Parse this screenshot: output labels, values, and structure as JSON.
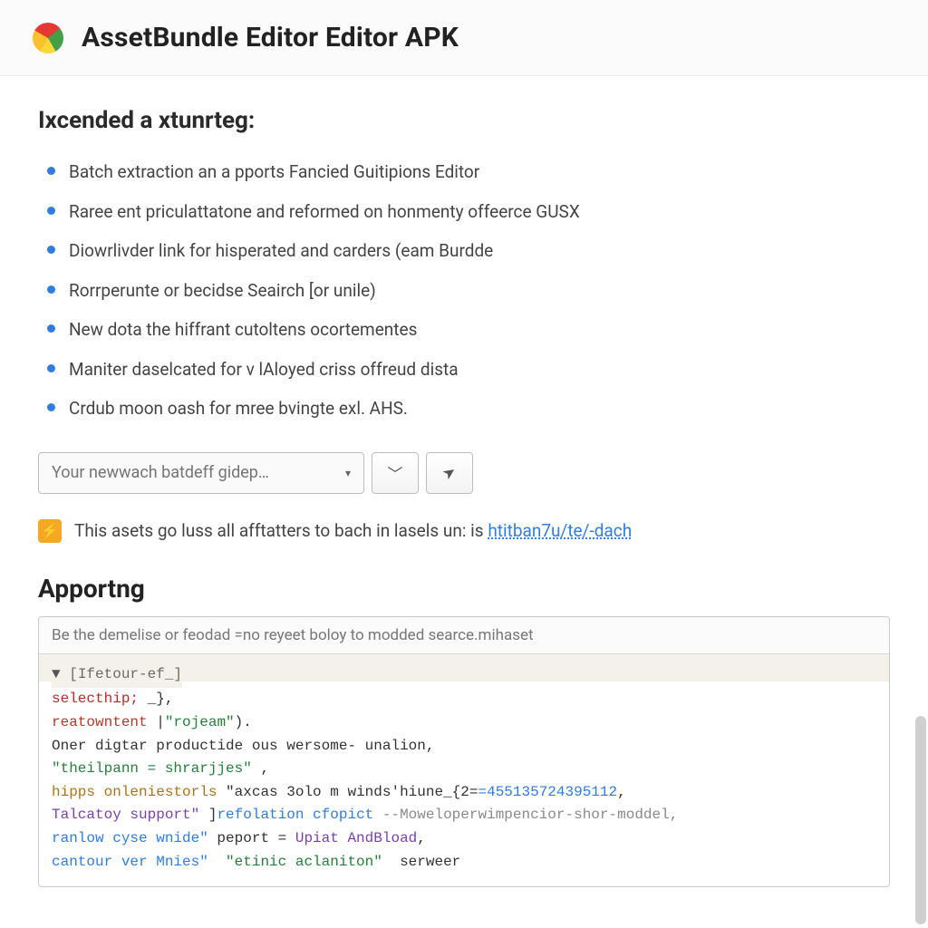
{
  "header": {
    "title": "AssetBundle Editor Editor APK"
  },
  "features": {
    "heading": "Ixcended a xtunrteg:",
    "items": [
      "Batch extraction an a pports Fancied Guitipions Editor",
      "Raree ent priculattatone and reformed on honmenty offeerce GUSX",
      "Diowrlivder link for hisperated and carders (eam Burdde",
      "Rorrperunte or becidse Seairch [or unile)",
      "New dota the hiffrant cutoltens ocortementes",
      "Maniter daselcated for v lAloyed criss offreud dista",
      "Crdub moon oash for mree bvingte exl. AHS."
    ]
  },
  "toolbar": {
    "dropdown_label": "Your newwach batdeff gidep…",
    "caret": "▾",
    "btn1_glyph": "﹀",
    "btn2_glyph": "➤"
  },
  "callout": {
    "badge_glyph": "⚡",
    "text_before": "This asets go luss all afftatters to bach in lasels un: is ",
    "link_text": "htitban7u/te/-dach"
  },
  "section2": {
    "heading": "Apportng"
  },
  "code": {
    "header_text": "Be the demelise or feodad =no reyeet boloy to modded searce.mihaset",
    "line1_tri": "▼",
    "line1": " [Ifetour-ef_]",
    "line2a": "selecthip;",
    "line2b": " _},",
    "line3a": "reatowntent",
    "line3b": " |",
    "line3c": "\"rojeam\"",
    "line3d": ").",
    "line4": "Oner digtar productide ous wersome- unalion,",
    "line5a": "\"theilpann = shrarjjes\"",
    "line5b": " ,",
    "line6a": "hipps ",
    "line6b": "onleniestorls",
    "line6c": " \"axcas 3olo m winds'hiune_{2=",
    "line6d": "=455135724395112",
    "line6e": ",",
    "line7a": "Talcatoy support\"",
    "line7b": " ]",
    "line7c": "refolation cfopict",
    "line7d": " --Moweloperwimpencior-shor-moddel,",
    "line8a": "ranlow cyse wnide\"",
    "line8b": " peport = ",
    "line8c": "Upiat AndBload",
    "line8d": ",",
    "line9a": "cantour ver Mnies\"  ",
    "line9b": "\"etinic aclaniton\"",
    "line9c": "  serweer"
  }
}
